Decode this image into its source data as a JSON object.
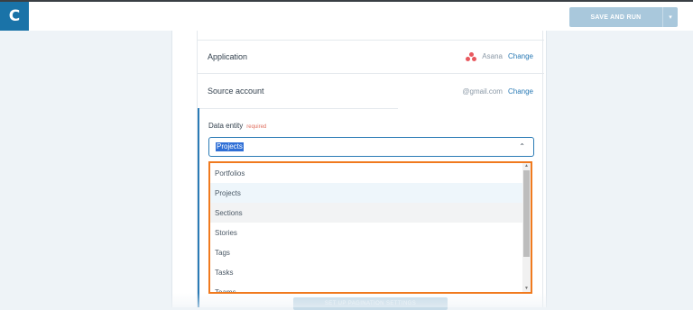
{
  "header": {
    "logo": "C",
    "save_label": "SAVE AND RUN",
    "caret": "▾"
  },
  "card": {
    "application": {
      "label": "Application",
      "value": "Asana",
      "change": "Change"
    },
    "source": {
      "label": "Source account",
      "value": "@gmail.com",
      "change": "Change"
    },
    "entity": {
      "label": "Data entity",
      "required": "required",
      "selected": "Projects",
      "chevron": "⌃"
    }
  },
  "dropdown": {
    "options": [
      "Portfolios",
      "Projects",
      "Sections",
      "Stories",
      "Tags",
      "Tasks",
      "Teams"
    ]
  },
  "footer": {
    "button_label": "SET UP PAGINATION SETTINGS"
  },
  "colors": {
    "accent": "#2a7ab5",
    "highlight": "#f07a1e",
    "brand": "#1a73a8"
  }
}
